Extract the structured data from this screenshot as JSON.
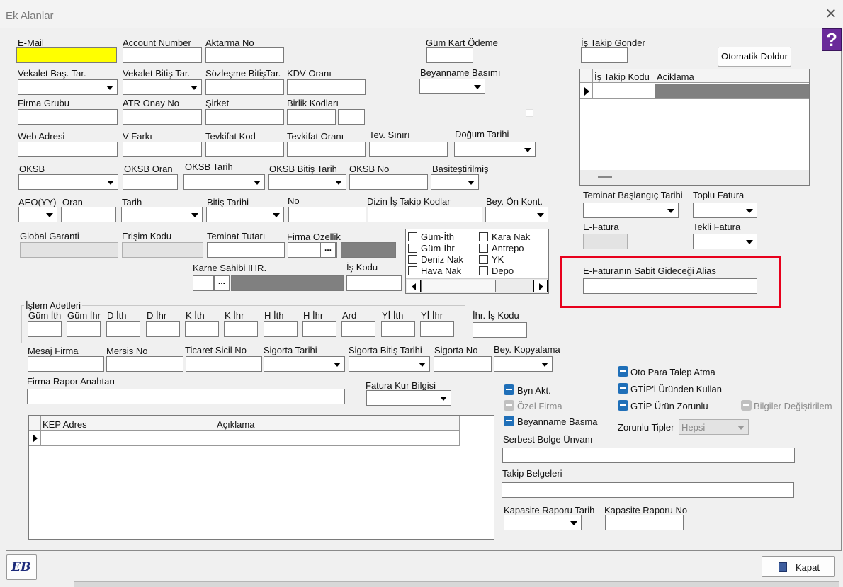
{
  "window": {
    "title": "Ek Alanlar",
    "close_glyph": "✕",
    "help_glyph": "?"
  },
  "colors": {
    "highlight_red": "#e8001c",
    "yellow_field": "#ffff00",
    "check_blue": "#1f6fb8"
  },
  "labels": {
    "email": "E-Mail",
    "account_number": "Account Number",
    "aktarma_no": "Aktarma No",
    "gum_kart_odeme": "Güm Kart Ödeme",
    "is_takip_gonder": "İş Takip Gonder",
    "vekalet_bas": "Vekalet Baş. Tar.",
    "vekalet_bitis": "Vekalet Bitiş Tar.",
    "sozlesme_bitis": "Sözleşme BitişTar.",
    "kdv_orani": "KDV Oranı",
    "beyanname_basimi": "Beyanname Basımı",
    "firma_grubu": "Firma Grubu",
    "atr_onay_no": "ATR Onay No",
    "sirket": "Şirket",
    "birlik_kodlari": "Birlik Kodları",
    "web_adresi": "Web Adresi",
    "v_farki": "V Farkı",
    "tevkifat_kod": "Tevkifat Kod",
    "tevkifat_orani": "Tevkifat Oranı",
    "tev_siniri": "Tev. Sınırı",
    "dogum_tarihi": "Doğum Tarihi",
    "oksb": "OKSB",
    "oksb_oran": "OKSB Oran",
    "oksb_tarih": "OKSB Tarih",
    "oksb_bitis_tarih": "OKSB Bitiş Tarih",
    "oksb_no": "OKSB No",
    "basitestirilmis": "Basiteştirilmiş",
    "aeo_yy": "AEO(YY)",
    "oran": "Oran",
    "tarih": "Tarih",
    "bitis_tarihi": "Bitiş Tarihi",
    "no": "No",
    "dizin_is_takip": "Dizin İş Takip Kodlar",
    "bey_on_kont": "Bey. Ön Kont.",
    "global_garanti": "Global Garanti",
    "erisim_kodu": "Erişim Kodu",
    "teminat_tutari": "Teminat Tutarı",
    "firma_ozellik": "Firma Ozellik",
    "karne_sahibi": "Karne Sahibi IHR.",
    "is_kodu": "İş Kodu",
    "teminat_baslangic": "Teminat Başlangıç Tarihi",
    "toplu_fatura": "Toplu Fatura",
    "e_fatura": "E-Fatura",
    "tekli_fatura": "Tekli Fatura",
    "e_fatura_alias": "E-Faturanın Sabit Gideceği Alias",
    "islem_adetleri": "İşlem Adetleri",
    "ihr_is_kodu": "İhr. İş Kodu",
    "mesaj_firma": "Mesaj Firma",
    "mersis_no": "Mersis No",
    "ticaret_sicil_no": "Ticaret Sicil No",
    "sigorta_tarihi": "Sigorta Tarihi",
    "sigorta_bitis_tarihi": "Sigorta Bitiş Tarihi",
    "sigorta_no": "Sigorta No",
    "bey_kopyalama": "Bey. Kopyalama",
    "firma_rapor_anahtari": "Firma Rapor Anahtarı",
    "fatura_kur_bilgisi": "Fatura Kur Bilgisi",
    "zorunlu_tipler": "Zorunlu Tipler",
    "serbest_bolge": "Serbest Bolge Ünvanı",
    "takip_belgeleri": "Takip Belgeleri",
    "kapasite_tarih": "Kapasite Raporu Tarih",
    "kapasite_no": "Kapasite Raporu No"
  },
  "islem_adetleri": [
    "Güm İth",
    "Güm İhr",
    "D İth",
    "D İhr",
    "K İth",
    "K İhr",
    "H İth",
    "H İhr",
    "Ard",
    "Yİ İth",
    "Yİ İhr"
  ],
  "tasima_list": {
    "col1": [
      "Güm-İth",
      "Güm-İhr",
      "Deniz Nak",
      "Hava Nak"
    ],
    "col2": [
      "Kara Nak",
      "Antrepo",
      "YK",
      "Depo"
    ]
  },
  "is_takip_grid": {
    "columns": [
      "İş Takip Kodu",
      "Aciklama"
    ]
  },
  "kep_grid": {
    "columns": [
      "KEP Adres",
      "Açıklama"
    ]
  },
  "checks": {
    "oto_para": "Oto Para Talep Atma",
    "gtip_urun_kullan": "GTİP'i Üründen Kullan",
    "gtip_zorunlu": "GTİP Ürün Zorunlu",
    "bilgiler": "Bilgiler Değiştirilem",
    "byn_akt": "Byn Akt.",
    "ozel_firma": "Özel Firma",
    "beyanname_basma": "Beyanname Basma"
  },
  "zorunlu_tipler_value": "Hepsi",
  "buttons": {
    "otomatik_doldur": "Otomatik Doldur",
    "kapat": "Kapat",
    "dots": "...",
    "eb_logo": "EB"
  }
}
